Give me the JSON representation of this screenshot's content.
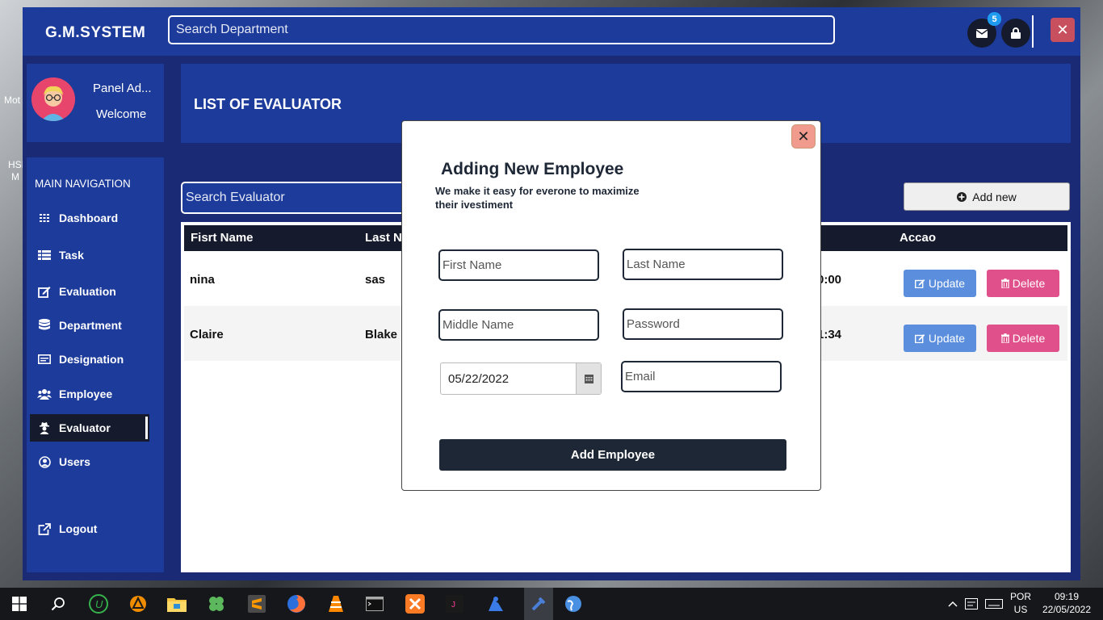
{
  "app": {
    "brand": "G.M.SYSTEM",
    "search_placeholder": "Search Department",
    "mail_count": "5",
    "close_symbol": "✕"
  },
  "profile": {
    "name": "Panel Ad...",
    "welcome": "Welcome"
  },
  "sidebar": {
    "title": "MAIN NAVIGATION",
    "items": [
      {
        "label": "Dashboard",
        "icon": "grid-icon"
      },
      {
        "label": "Task",
        "icon": "list-icon"
      },
      {
        "label": "Evaluation",
        "icon": "edit-icon"
      },
      {
        "label": "Department",
        "icon": "database-icon"
      },
      {
        "label": "Designation",
        "icon": "card-icon"
      },
      {
        "label": "Employee",
        "icon": "users-icon"
      },
      {
        "label": "Evaluator",
        "icon": "user-secret-icon",
        "active": true
      },
      {
        "label": "Users",
        "icon": "user-circle-icon"
      },
      {
        "label": "Logout",
        "icon": "external-link-icon"
      }
    ]
  },
  "main": {
    "title": "LIST OF EVALUATOR",
    "search_placeholder": "Search Evaluator",
    "add_new_label": "Add new",
    "table": {
      "headers": [
        "Fisrt Name",
        "Last N",
        "Accao"
      ],
      "rows": [
        {
          "first": "nina",
          "last": "sas",
          "time": "0:00"
        },
        {
          "first": "Claire",
          "last": "Blake",
          "time": "1:34"
        }
      ],
      "update_label": "Update",
      "delete_label": "Delete"
    }
  },
  "modal": {
    "title": "Adding New Employee",
    "subtitle": "We make it easy for everone to maximize their ivestiment",
    "first_name_placeholder": "First Name",
    "last_name_placeholder": "Last Name",
    "middle_name_placeholder": "Middle Name",
    "password_placeholder": "Password",
    "date_value": "05/22/2022",
    "email_placeholder": "Email",
    "submit_label": "Add Employee",
    "close_symbol": "✕"
  },
  "taskbar": {
    "lang_top": "POR",
    "lang_bottom": "US",
    "time": "09:19",
    "date": "22/05/2022"
  },
  "desktop": {
    "icon_label_1": "Mot",
    "icon_label_2": "HSI",
    "icon_label_3": "M"
  }
}
